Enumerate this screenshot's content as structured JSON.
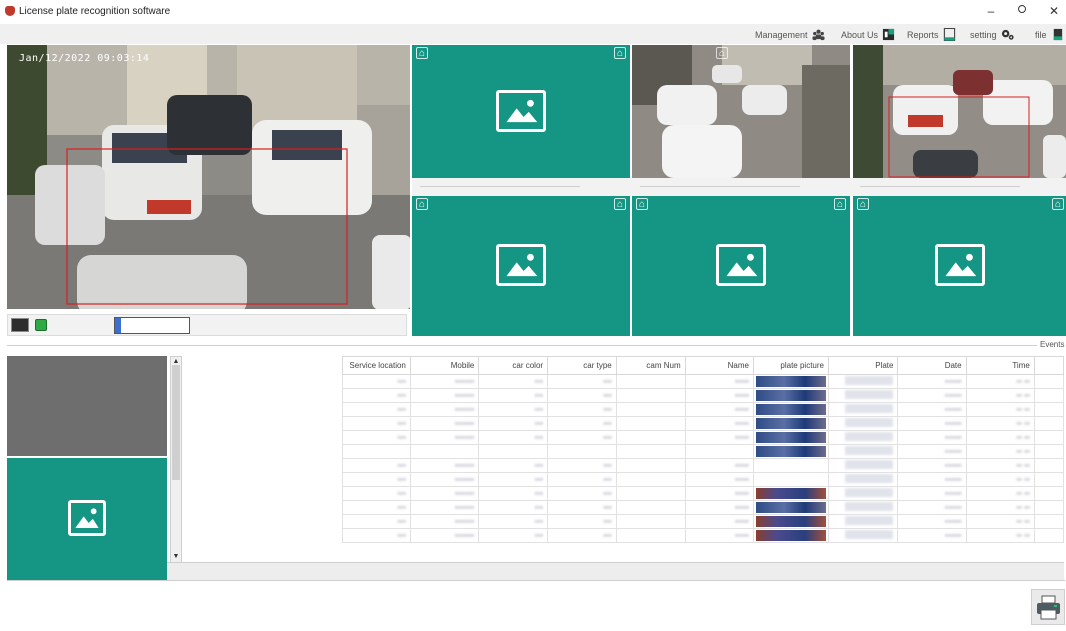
{
  "window": {
    "title": "License plate recognition software",
    "minimize": "–",
    "maximize": "□",
    "close": "✕"
  },
  "menu": {
    "management": "Management",
    "about": "About Us",
    "reports": "Reports",
    "setting": "setting",
    "file": "file"
  },
  "camera": {
    "timestamp": "Jan/12/2022 09:03:14"
  },
  "events_label": "Events",
  "grid": {
    "columns": [
      "Service location",
      "Mobile",
      "car color",
      "car type",
      "cam Num",
      "Name",
      "plate picture",
      "Plate",
      "Date",
      "Time"
    ],
    "rows": [
      [
        "•••",
        "•••••••",
        "•••",
        "•••",
        "",
        "•••••",
        "blue",
        "•• • •••• ••",
        "••••••",
        "•• ••"
      ],
      [
        "•••",
        "•••••••",
        "•••",
        "•••",
        "",
        "•••••",
        "blue",
        "•• • •••• ••",
        "••••••",
        "•• ••"
      ],
      [
        "•••",
        "•••••••",
        "•••",
        "•••",
        "",
        "•••••",
        "blue",
        "•• • •••• ••",
        "••••••",
        "•• ••"
      ],
      [
        "•••",
        "•••••••",
        "•••",
        "•••",
        "",
        "•••••",
        "blue",
        "•• • •••• ••",
        "••••••",
        "•• ••"
      ],
      [
        "•••",
        "•••••••",
        "•••",
        "•••",
        "",
        "•••••",
        "blue",
        "•• • •••• ••",
        "••••••",
        "•• ••"
      ],
      [
        "",
        "",
        "",
        "",
        "",
        "",
        "blue",
        "•• • •••• ••",
        "••••••",
        "•• ••"
      ],
      [
        "•••",
        "•••••••",
        "•••",
        "•••",
        "",
        "•••••",
        "white",
        "•• • •••• ••",
        "••••••",
        "•• ••"
      ],
      [
        "•••",
        "•••••••",
        "•••",
        "•••",
        "",
        "•••••",
        "white",
        "•• • •••• ••",
        "••••••",
        "•• ••"
      ],
      [
        "•••",
        "•••••••",
        "•••",
        "•••",
        "",
        "•••••",
        "red",
        "•• • •••• ••",
        "••••••",
        "•• ••"
      ],
      [
        "•••",
        "•••••••",
        "•••",
        "•••",
        "",
        "•••••",
        "blue",
        "•• • •••• ••",
        "••••••",
        "•• ••"
      ],
      [
        "•••",
        "•••••••",
        "•••",
        "•••",
        "",
        "•••••",
        "red",
        "•• • •••• ••",
        "••••••",
        "•• ••"
      ],
      [
        "•••",
        "•••••••",
        "•••",
        "•••",
        "",
        "•••••",
        "red",
        "•• • •••• ••",
        "••••••",
        "•• ••"
      ]
    ]
  }
}
